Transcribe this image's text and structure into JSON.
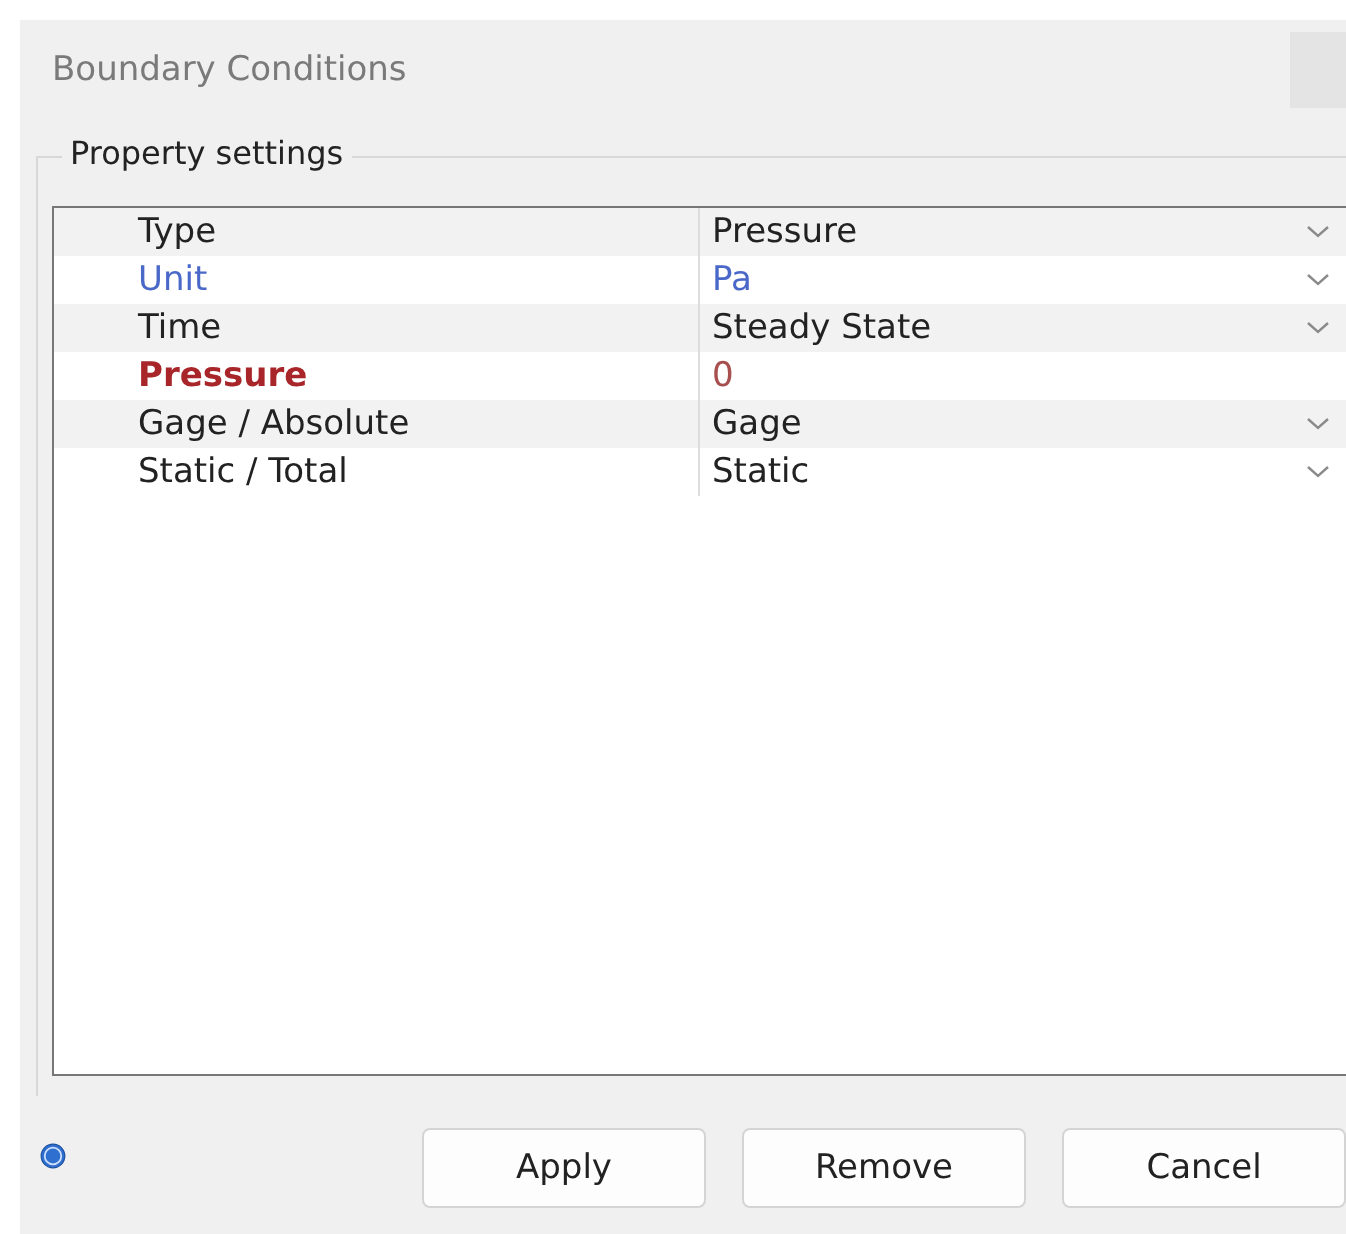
{
  "window": {
    "title": "Boundary Conditions"
  },
  "group": {
    "title": "Property settings"
  },
  "properties": [
    {
      "label": "Type",
      "value": "Pressure",
      "kind": "dropdown",
      "linked": false,
      "required": false
    },
    {
      "label": "Unit",
      "value": "Pa",
      "kind": "dropdown",
      "linked": true,
      "required": false
    },
    {
      "label": "Time",
      "value": "Steady State",
      "kind": "dropdown",
      "linked": false,
      "required": false
    },
    {
      "label": "Pressure",
      "value": "0",
      "kind": "input",
      "linked": false,
      "required": true
    },
    {
      "label": "Gage / Absolute",
      "value": "Gage",
      "kind": "dropdown",
      "linked": false,
      "required": false
    },
    {
      "label": "Static / Total",
      "value": "Static",
      "kind": "dropdown",
      "linked": false,
      "required": false
    }
  ],
  "buttons": [
    "Apply",
    "Remove",
    "Cancel"
  ]
}
